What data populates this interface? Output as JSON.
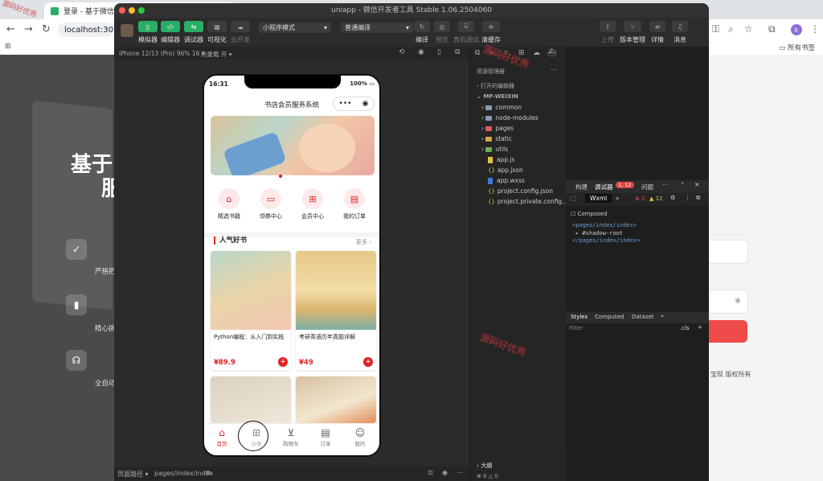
{
  "chrome": {
    "tab_title": "登录 - 基于微信小程序",
    "url": "localhost:30",
    "bookmarks_label": "所有书签",
    "profile_initial": "k"
  },
  "background_page": {
    "title_line1": "基于",
    "title_line2": "服",
    "features": [
      "严格把",
      "精心挑",
      "全自动"
    ],
    "footer": "宝现 版权所有"
  },
  "ide": {
    "title": "uniapp - 微信开发者工具 Stable 1.06.2504060",
    "toolbar": {
      "simulator": "模拟器",
      "editor": "编辑器",
      "debugger": "调试器",
      "visualize": "可视化",
      "cloud": "云开发",
      "mode_select": "小程序模式",
      "compile_select": "普通编译",
      "compile": "编译",
      "preview": "预览",
      "real_debug": "真机调试",
      "clear_cache": "清缓存",
      "upload": "上传",
      "version": "版本管理",
      "details": "详情",
      "messages": "消息"
    },
    "sim_bar": {
      "device": "iPhone 12/13 (Pro) 96% 16 ▾",
      "hot_reload": "热重载 开 ▾"
    },
    "status_bar": {
      "path_label": "页面路径 ▾",
      "path": "pages/index/index"
    },
    "file_tree": {
      "header": "资源管理器",
      "open_editors": "打开的编辑器",
      "project": "MP-WEIXIN",
      "items": [
        "common",
        "node-modules",
        "pages",
        "static",
        "utils",
        "app.js",
        "app.json",
        "app.wxss",
        "project.config.json",
        "project.private.config..."
      ],
      "outline": "大纲",
      "errors": "0",
      "warnings": "0"
    },
    "devtools": {
      "tabs": [
        "构建",
        "调试器",
        "问题"
      ],
      "badge": "2, 12",
      "sub_tab": "Wxml",
      "err_count": "2",
      "warn_count": "12",
      "composed": "Composed",
      "tree_lines": [
        "<pages/index/index>",
        "▸ #shadow-root",
        "</pages/index/index>"
      ],
      "styles_tabs": [
        "Styles",
        "Computed",
        "Dataset"
      ],
      "filter": "Filter",
      "cls": ".cls"
    }
  },
  "phone": {
    "time": "16:31",
    "battery": "100%",
    "nav_title": "书店会员服务系统",
    "menu": [
      {
        "label": "精选书籍",
        "icon": "home-icon"
      },
      {
        "label": "领券中心",
        "icon": "ticket-icon"
      },
      {
        "label": "会员中心",
        "icon": "gift-icon"
      },
      {
        "label": "我的订单",
        "icon": "document-icon"
      }
    ],
    "section_title": "人气好书",
    "more": "更多 ›",
    "books": [
      {
        "name": "Python编程：从入门到实践",
        "price": "¥89.9"
      },
      {
        "name": "考研英语历年真题详解",
        "price": "¥49"
      },
      {
        "name": "",
        "price": ""
      },
      {
        "name": "",
        "price": ""
      }
    ],
    "tabs": [
      {
        "label": "首页",
        "icon": "home-icon"
      },
      {
        "label": "分类",
        "icon": "grid-icon"
      },
      {
        "label": "购物车",
        "icon": "cart-icon"
      },
      {
        "label": "订单",
        "icon": "order-icon"
      },
      {
        "label": "我的",
        "icon": "user-icon"
      }
    ]
  },
  "watermark": "源码好优秀"
}
